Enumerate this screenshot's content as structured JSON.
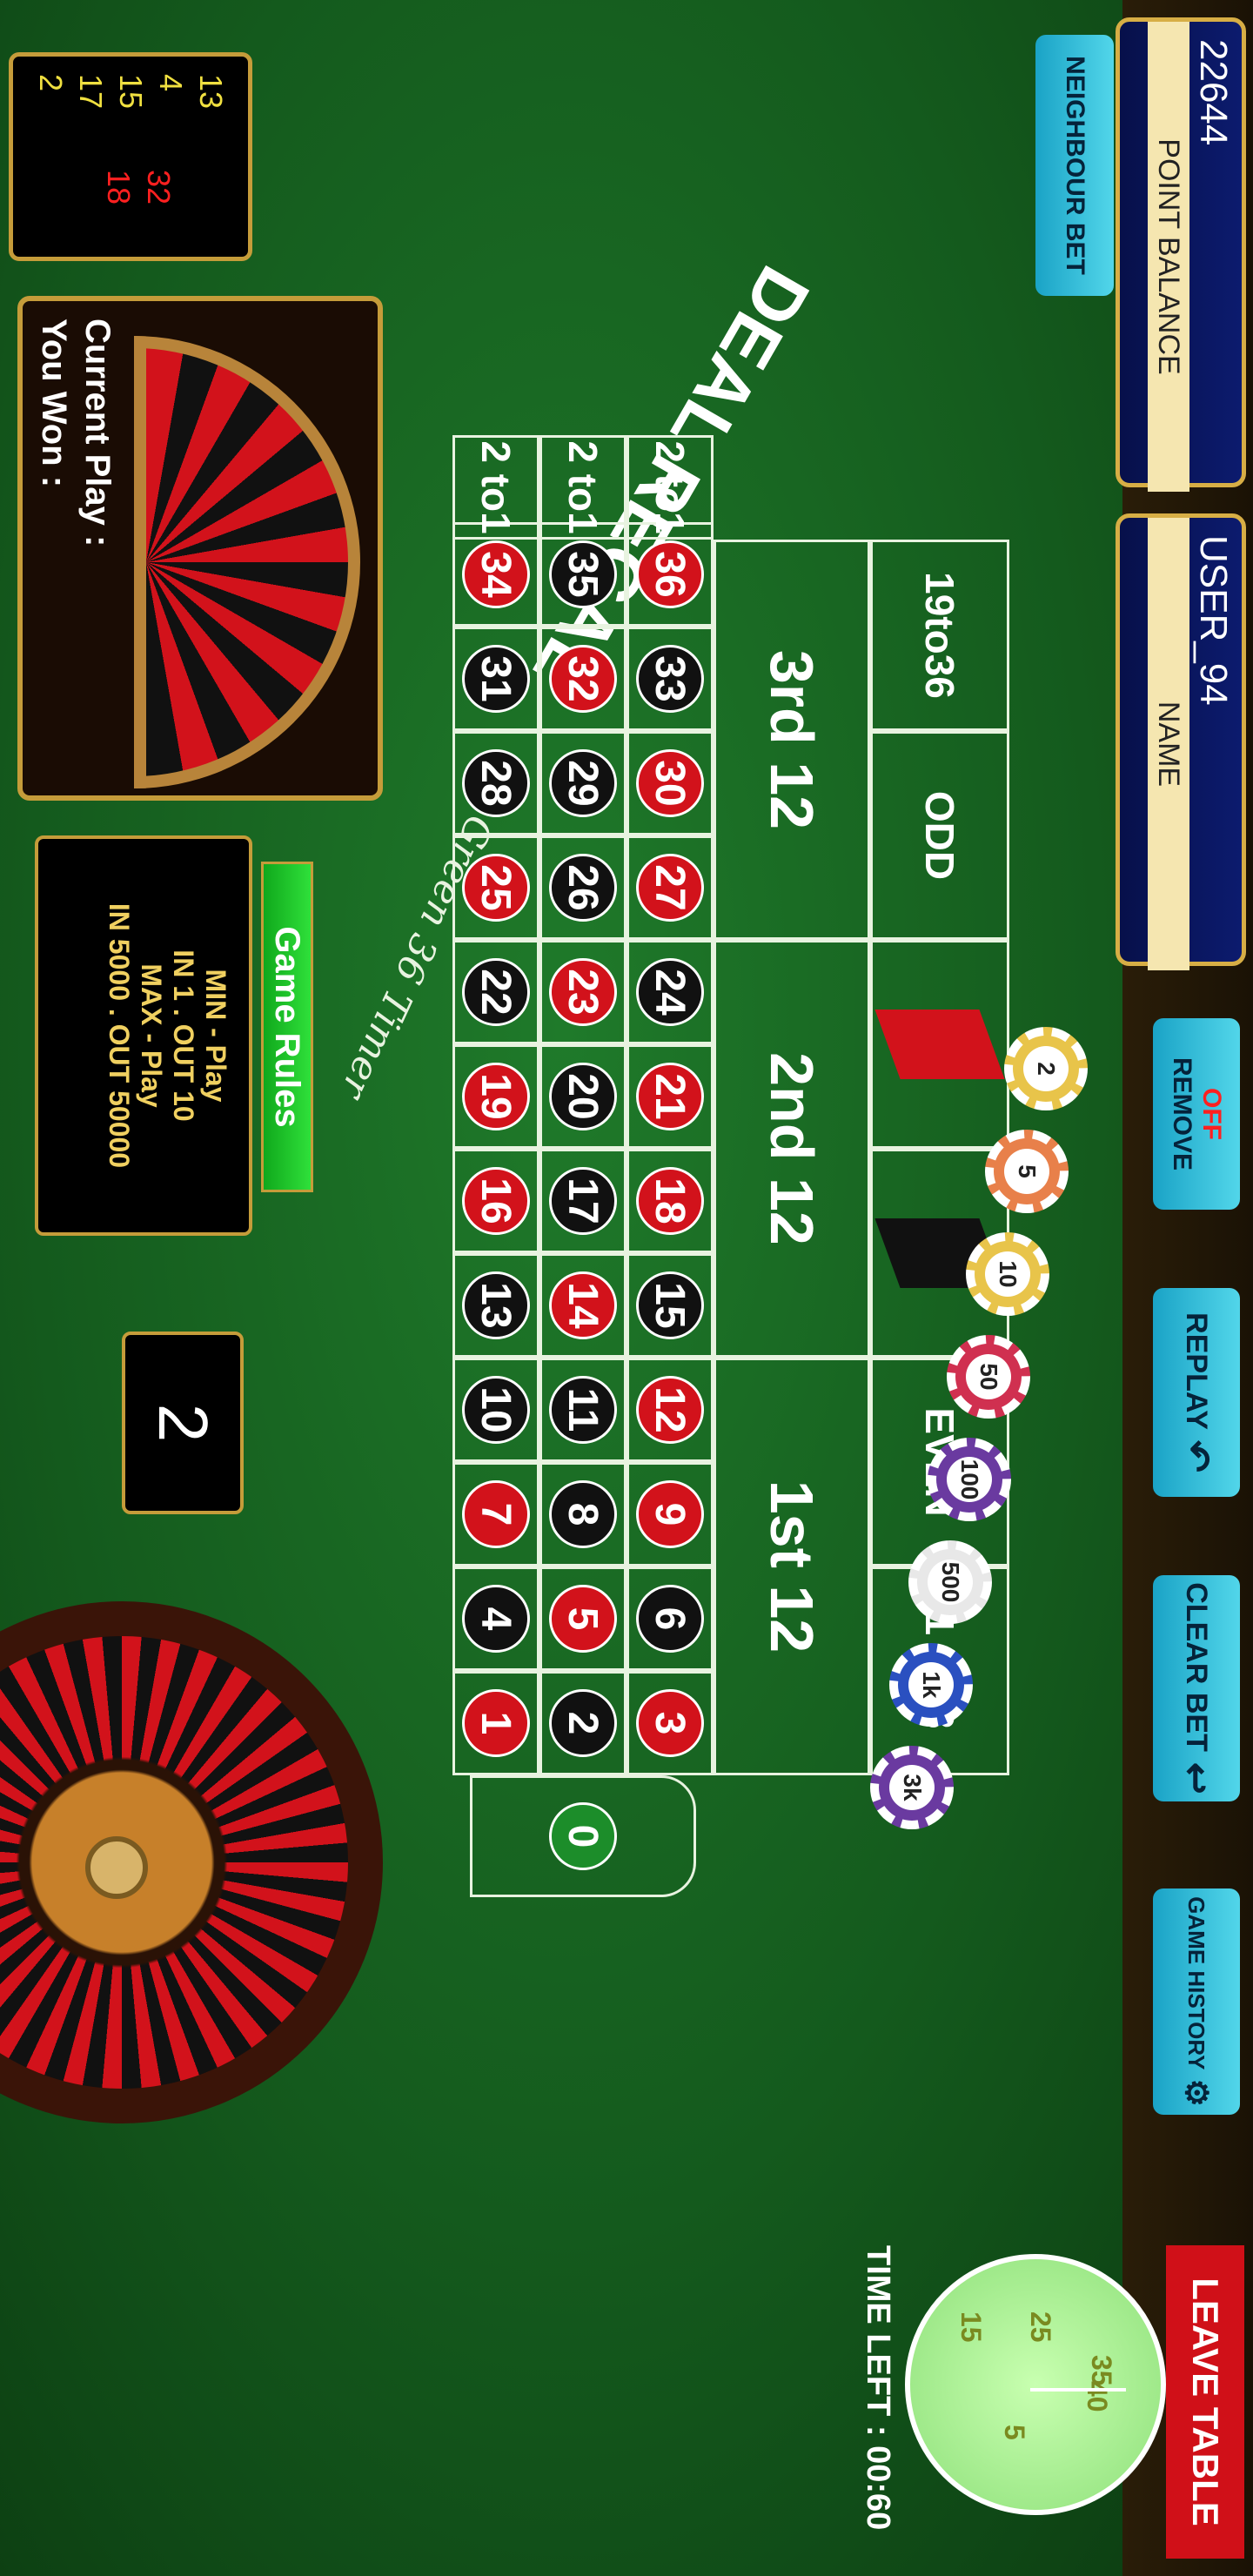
{
  "player": {
    "name_label": "NAME",
    "name_value": "USER_94",
    "balance_label": "POINT BALANCE",
    "balance_value": "22644"
  },
  "buttons": {
    "neighbour_bet": "NEIGHBOUR BET",
    "remove_state": "OFF",
    "remove": "REMOVE",
    "replay": "REPLAY",
    "clear_bet": "CLEAR BET",
    "game_history": "GAME HISTORY",
    "leave_table": "LEAVE TABLE",
    "game_rules": "Game Rules"
  },
  "table": {
    "name": "DEAL REGAL",
    "timer_caption": "Green 36 Timer",
    "zero": "0",
    "rows": [
      [
        {
          "n": "3",
          "c": "red"
        },
        {
          "n": "6",
          "c": "black"
        },
        {
          "n": "9",
          "c": "red"
        },
        {
          "n": "12",
          "c": "red"
        },
        {
          "n": "15",
          "c": "black"
        },
        {
          "n": "18",
          "c": "red"
        },
        {
          "n": "21",
          "c": "red"
        },
        {
          "n": "24",
          "c": "black"
        },
        {
          "n": "27",
          "c": "red"
        },
        {
          "n": "30",
          "c": "red"
        },
        {
          "n": "33",
          "c": "black"
        },
        {
          "n": "36",
          "c": "red"
        }
      ],
      [
        {
          "n": "2",
          "c": "black"
        },
        {
          "n": "5",
          "c": "red"
        },
        {
          "n": "8",
          "c": "black"
        },
        {
          "n": "11",
          "c": "black"
        },
        {
          "n": "14",
          "c": "red"
        },
        {
          "n": "17",
          "c": "black"
        },
        {
          "n": "20",
          "c": "black"
        },
        {
          "n": "23",
          "c": "red"
        },
        {
          "n": "26",
          "c": "black"
        },
        {
          "n": "29",
          "c": "black"
        },
        {
          "n": "32",
          "c": "red"
        },
        {
          "n": "35",
          "c": "black"
        }
      ],
      [
        {
          "n": "1",
          "c": "red"
        },
        {
          "n": "4",
          "c": "black"
        },
        {
          "n": "7",
          "c": "red"
        },
        {
          "n": "10",
          "c": "black"
        },
        {
          "n": "13",
          "c": "black"
        },
        {
          "n": "16",
          "c": "red"
        },
        {
          "n": "19",
          "c": "red"
        },
        {
          "n": "22",
          "c": "black"
        },
        {
          "n": "25",
          "c": "red"
        },
        {
          "n": "28",
          "c": "black"
        },
        {
          "n": "31",
          "c": "black"
        },
        {
          "n": "34",
          "c": "red"
        }
      ]
    ],
    "columns": [
      "2 to1",
      "2 to1",
      "2 to1"
    ],
    "dozens": [
      "1st 12",
      "2nd 12",
      "3rd 12"
    ],
    "outside": [
      "1 to18",
      "EVEN",
      "",
      "",
      "ODD",
      "19to36"
    ],
    "colors": {
      "red": "#d2121b",
      "black": "#111111",
      "felt": "#145a1d",
      "gold": "#d7ae45"
    }
  },
  "chips": [
    "2",
    "5",
    "10",
    "50",
    "100",
    "500",
    "1k",
    "3k"
  ],
  "history": {
    "col1": [
      "13",
      "4",
      "15",
      "17",
      "2"
    ],
    "col2": [
      "32",
      "18"
    ]
  },
  "current_play": {
    "label": "Current Play :",
    "won_label": "You Won :"
  },
  "limits": {
    "line1": "MIN - Play",
    "line2": "IN 1 .  OUT 10",
    "line3": "MAX - Play",
    "line4": "IN 5000 .  OUT 50000"
  },
  "last_number": "2",
  "timer": {
    "label": "TIME LEFT : 00:60",
    "dial": [
      "35",
      "40",
      "5",
      "15",
      "25"
    ]
  }
}
